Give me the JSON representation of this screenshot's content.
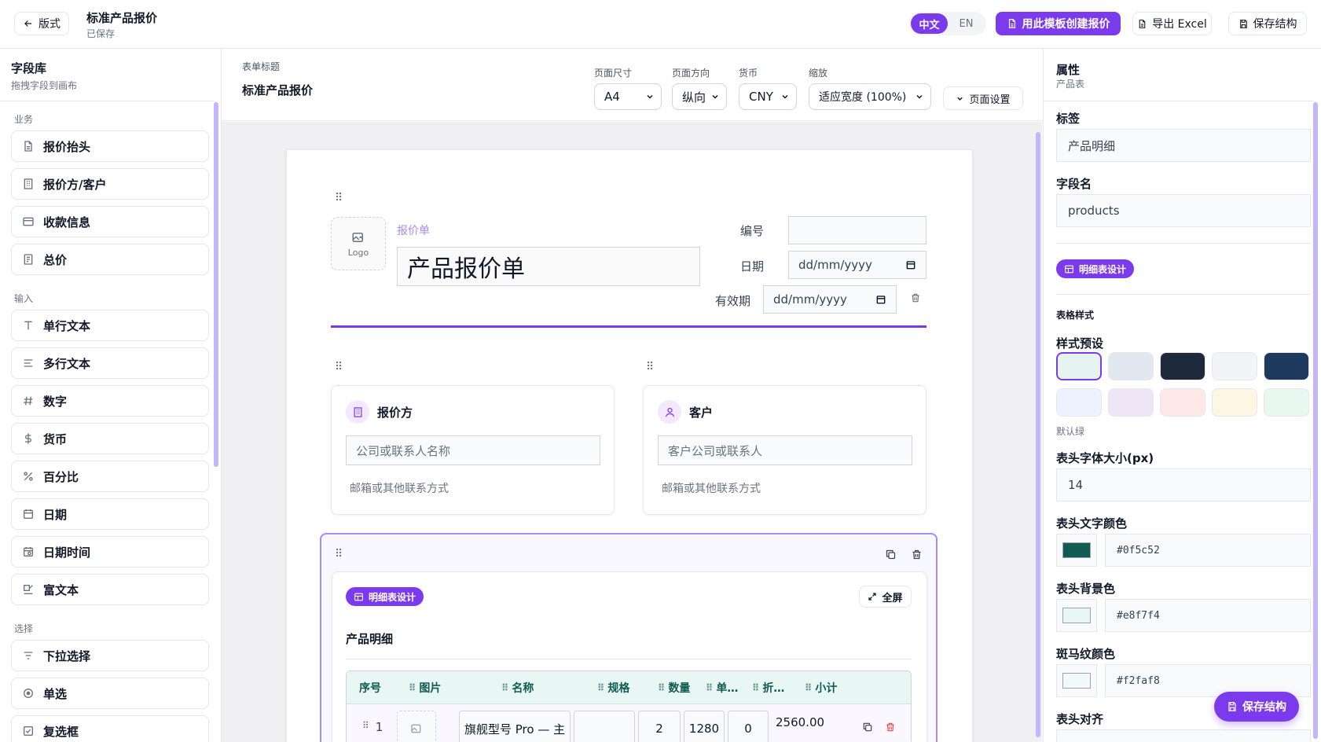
{
  "topbar": {
    "back_label": "版式",
    "doc_title": "标准产品报价",
    "doc_status": "已保存",
    "lang_zh": "中文",
    "lang_en": "EN",
    "create_label": "用此模板创建报价",
    "export_label": "导出 Excel",
    "save_label": "保存结构"
  },
  "library": {
    "title": "字段库",
    "subtitle": "拖拽字段到画布",
    "groups": [
      {
        "label": "业务",
        "items": [
          {
            "label": "报价抬头",
            "icon": "document-icon"
          },
          {
            "label": "报价方/客户",
            "icon": "building-icon"
          },
          {
            "label": "收款信息",
            "icon": "wallet-icon"
          },
          {
            "label": "总价",
            "icon": "receipt-icon"
          }
        ]
      },
      {
        "label": "输入",
        "items": [
          {
            "label": "单行文本",
            "icon": "text-icon"
          },
          {
            "label": "多行文本",
            "icon": "align-left-icon"
          },
          {
            "label": "数字",
            "icon": "hash-icon"
          },
          {
            "label": "货币",
            "icon": "dollar-icon"
          },
          {
            "label": "百分比",
            "icon": "percent-icon"
          },
          {
            "label": "日期",
            "icon": "calendar-icon"
          },
          {
            "label": "日期时间",
            "icon": "calendar-clock-icon"
          },
          {
            "label": "富文本",
            "icon": "edit-icon"
          }
        ]
      },
      {
        "label": "选择",
        "items": [
          {
            "label": "下拉选择",
            "icon": "filter-icon"
          },
          {
            "label": "单选",
            "icon": "radio-icon"
          },
          {
            "label": "复选框",
            "icon": "checkbox-icon"
          }
        ]
      }
    ]
  },
  "form_header": {
    "title_label": "表单标题",
    "title_value": "标准产品报价",
    "page_size": {
      "label": "页面尺寸",
      "value": "A4"
    },
    "orientation": {
      "label": "页面方向",
      "value": "纵向"
    },
    "currency": {
      "label": "货币",
      "value": "CNY"
    },
    "zoom": {
      "label": "缩放",
      "value": "适应宽度 (100%)"
    },
    "page_setup_label": "页面设置"
  },
  "quote": {
    "logo_label": "Logo",
    "doc_type_label": "报价单",
    "doc_title": "产品报价单",
    "number_label": "编号",
    "number_value": "",
    "date_label": "日期",
    "date_placeholder": "dd/mm/yyyy",
    "validity_label": "有效期",
    "validity_placeholder": "dd/mm/yyyy",
    "quoter": {
      "title": "报价方",
      "name_placeholder": "公司或联系人名称",
      "contact_placeholder": "邮箱或其他联系方式"
    },
    "customer": {
      "title": "客户",
      "name_placeholder": "客户公司或联系人",
      "contact_placeholder": "邮箱或其他联系方式"
    },
    "detail": {
      "design_pill": "明细表设计",
      "fullscreen_label": "全屏",
      "title": "产品明细",
      "columns": [
        "序号",
        "图片",
        "名称",
        "规格",
        "数量",
        "单…",
        "折…",
        "小计"
      ],
      "rows": [
        {
          "index": "1",
          "name": "旗舰型号 Pro — 主",
          "spec": "",
          "qty": "2",
          "price": "1280",
          "discount": "0",
          "subtotal": "2560.00"
        }
      ]
    }
  },
  "properties": {
    "title": "属性",
    "subtitle": "产品表",
    "label_label": "标签",
    "label_value": "产品明细",
    "field_name_label": "字段名",
    "field_name_value": "products",
    "design_pill": "明细表设计",
    "table_style_label": "表格样式",
    "preset_label": "样式预设",
    "preset_caption": "默认绿",
    "presets": [
      "#e6f4f1",
      "#e2e8f0",
      "#1e293b",
      "#f3f4f6",
      "#1e3a5f",
      "#eef2ff",
      "#ede4f5",
      "#fde8e8",
      "#fdf6e3",
      "#e8f7ef"
    ],
    "header_font_label": "表头字体大小(px)",
    "header_font_value": "14",
    "header_text_color_label": "表头文字颜色",
    "header_text_color": "#0f5c52",
    "header_bg_label": "表头背景色",
    "header_bg_color": "#e8f7f4",
    "zebra_label": "斑马纹颜色",
    "zebra_color": "#f2faf8",
    "align_label": "表头对齐"
  },
  "fab_label": "保存结构",
  "accent_color": "#7c3aed"
}
